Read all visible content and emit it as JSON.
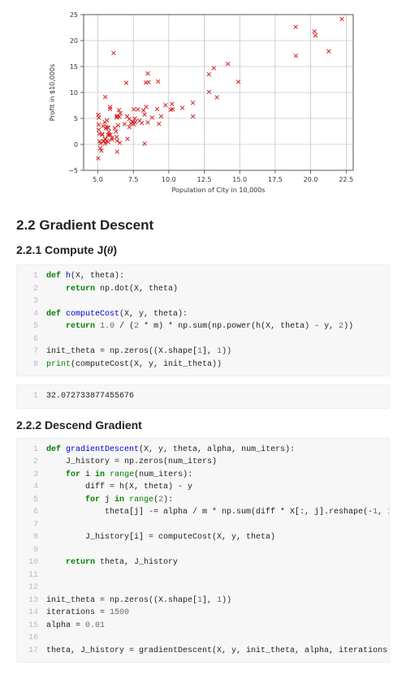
{
  "chart_data": {
    "type": "scatter",
    "xlabel": "Population of City in 10,000s",
    "ylabel": "Profit in $10,000s",
    "xlim": [
      4,
      23
    ],
    "ylim": [
      -5,
      25
    ],
    "xticks": [
      5.0,
      7.5,
      10.0,
      12.5,
      15.0,
      17.5,
      20.0,
      22.5
    ],
    "yticks": [
      -5,
      0,
      5,
      10,
      15,
      20,
      25
    ],
    "marker": "x",
    "marker_color": "#d62728",
    "points": [
      [
        6.1101,
        17.592
      ],
      [
        5.5277,
        9.1302
      ],
      [
        8.5186,
        13.662
      ],
      [
        7.0032,
        11.854
      ],
      [
        5.8598,
        6.8233
      ],
      [
        8.3829,
        11.886
      ],
      [
        7.4764,
        4.3483
      ],
      [
        8.5781,
        12.0
      ],
      [
        6.4862,
        6.5987
      ],
      [
        5.0546,
        3.8166
      ],
      [
        5.7107,
        3.2522
      ],
      [
        14.164,
        15.505
      ],
      [
        5.734,
        3.1551
      ],
      [
        8.4084,
        7.2258
      ],
      [
        5.6407,
        0.71618
      ],
      [
        5.3794,
        3.5129
      ],
      [
        6.3654,
        5.3048
      ],
      [
        5.1301,
        0.56077
      ],
      [
        6.4296,
        3.6518
      ],
      [
        7.0708,
        5.3893
      ],
      [
        6.1891,
        3.1386
      ],
      [
        20.27,
        21.767
      ],
      [
        5.4901,
        4.263
      ],
      [
        6.3261,
        5.1875
      ],
      [
        5.5649,
        3.0825
      ],
      [
        18.945,
        22.638
      ],
      [
        12.828,
        13.501
      ],
      [
        10.957,
        7.0467
      ],
      [
        13.176,
        14.692
      ],
      [
        22.203,
        24.147
      ],
      [
        5.2524,
        -1.22
      ],
      [
        6.5894,
        5.9966
      ],
      [
        9.2482,
        12.134
      ],
      [
        5.8918,
        1.8495
      ],
      [
        8.2111,
        6.5426
      ],
      [
        7.9334,
        4.5623
      ],
      [
        8.0959,
        4.1164
      ],
      [
        5.6063,
        3.3928
      ],
      [
        12.836,
        10.117
      ],
      [
        6.3534,
        5.4974
      ],
      [
        5.4069,
        0.55657
      ],
      [
        6.8825,
        3.9115
      ],
      [
        11.708,
        5.3854
      ],
      [
        5.7737,
        2.4406
      ],
      [
        7.8247,
        6.7318
      ],
      [
        7.0931,
        1.0463
      ],
      [
        5.0702,
        5.1337
      ],
      [
        5.8014,
        1.844
      ],
      [
        11.7,
        8.0043
      ],
      [
        5.5416,
        1.0179
      ],
      [
        7.5402,
        6.7504
      ],
      [
        5.3077,
        1.8396
      ],
      [
        7.4239,
        4.2885
      ],
      [
        7.6031,
        4.9981
      ],
      [
        6.3328,
        1.4233
      ],
      [
        6.3589,
        -1.4211
      ],
      [
        6.2742,
        2.4756
      ],
      [
        5.6397,
        4.6042
      ],
      [
        9.3102,
        3.9624
      ],
      [
        9.4536,
        5.4141
      ],
      [
        8.8254,
        5.1694
      ],
      [
        5.1793,
        -0.74279
      ],
      [
        21.279,
        17.929
      ],
      [
        14.908,
        12.054
      ],
      [
        18.959,
        17.054
      ],
      [
        7.2182,
        4.8852
      ],
      [
        8.2951,
        5.7442
      ],
      [
        10.236,
        7.7754
      ],
      [
        5.4994,
        1.0173
      ],
      [
        20.341,
        20.992
      ],
      [
        10.136,
        6.6799
      ],
      [
        7.3345,
        4.0259
      ],
      [
        6.0062,
        1.2784
      ],
      [
        7.2259,
        3.3411
      ],
      [
        5.0269,
        -2.6807
      ],
      [
        6.5479,
        0.29678
      ],
      [
        7.5386,
        3.8845
      ],
      [
        5.0365,
        5.7014
      ],
      [
        10.274,
        6.7526
      ],
      [
        5.1077,
        2.0576
      ],
      [
        5.7292,
        0.47953
      ],
      [
        5.1884,
        0.20421
      ],
      [
        6.3557,
        0.67861
      ],
      [
        9.7687,
        7.5435
      ],
      [
        6.5159,
        5.3436
      ],
      [
        8.5172,
        4.2415
      ],
      [
        9.1802,
        6.7981
      ],
      [
        6.002,
        0.92695
      ],
      [
        5.5204,
        0.152
      ],
      [
        5.0594,
        2.8214
      ],
      [
        5.7077,
        1.8451
      ],
      [
        7.6366,
        4.2959
      ],
      [
        5.8707,
        7.2029
      ],
      [
        5.3054,
        1.9869
      ],
      [
        8.2934,
        0.14454
      ],
      [
        13.394,
        9.0551
      ],
      [
        5.4369,
        0.61705
      ]
    ]
  },
  "sections": {
    "h2": "2.2 Gradient Descent",
    "h3a_prefix": "2.2.1 Compute J(",
    "h3a_theta": "θ",
    "h3a_suffix": ")",
    "h3b": "2.2.2 Descend Gradient"
  },
  "code1": {
    "lines": [
      [
        [
          "kw",
          "def"
        ],
        [
          "txt",
          " "
        ],
        [
          "fn",
          "h"
        ],
        [
          "txt",
          "(X, theta):"
        ]
      ],
      [
        [
          "txt",
          "    "
        ],
        [
          "kw",
          "return"
        ],
        [
          "txt",
          " np.dot(X, theta)"
        ]
      ],
      [
        [
          "txt",
          ""
        ]
      ],
      [
        [
          "kw",
          "def"
        ],
        [
          "txt",
          " "
        ],
        [
          "fn",
          "computeCost"
        ],
        [
          "txt",
          "(X, y, theta):"
        ]
      ],
      [
        [
          "txt",
          "    "
        ],
        [
          "kw",
          "return"
        ],
        [
          "txt",
          " "
        ],
        [
          "num",
          "1.0"
        ],
        [
          "txt",
          " / ("
        ],
        [
          "num",
          "2"
        ],
        [
          "txt",
          " * m) * np.sum(np.power(h(X, theta) - y, "
        ],
        [
          "num",
          "2"
        ],
        [
          "txt",
          "))"
        ]
      ],
      [
        [
          "txt",
          ""
        ]
      ],
      [
        [
          "txt",
          "init_theta = np.zeros((X.shape["
        ],
        [
          "num",
          "1"
        ],
        [
          "txt",
          "], "
        ],
        [
          "num",
          "1"
        ],
        [
          "txt",
          "))"
        ]
      ],
      [
        [
          "builtin",
          "print"
        ],
        [
          "txt",
          "(computeCost(X, y, init_theta))"
        ]
      ]
    ]
  },
  "output1": {
    "lines": [
      [
        [
          "txt",
          "32.072733877455676"
        ]
      ]
    ]
  },
  "code2": {
    "lines": [
      [
        [
          "kw",
          "def"
        ],
        [
          "txt",
          " "
        ],
        [
          "fn",
          "gradientDescent"
        ],
        [
          "txt",
          "(X, y, theta, alpha, num_iters):"
        ]
      ],
      [
        [
          "txt",
          "    J_history = np.zeros(num_iters)"
        ]
      ],
      [
        [
          "txt",
          "    "
        ],
        [
          "kw",
          "for"
        ],
        [
          "txt",
          " i "
        ],
        [
          "kw",
          "in"
        ],
        [
          "txt",
          " "
        ],
        [
          "builtin",
          "range"
        ],
        [
          "txt",
          "(num_iters):"
        ]
      ],
      [
        [
          "txt",
          "        diff = h(X, theta) - y"
        ]
      ],
      [
        [
          "txt",
          "        "
        ],
        [
          "kw",
          "for"
        ],
        [
          "txt",
          " j "
        ],
        [
          "kw",
          "in"
        ],
        [
          "txt",
          " "
        ],
        [
          "builtin",
          "range"
        ],
        [
          "txt",
          "("
        ],
        [
          "num",
          "2"
        ],
        [
          "txt",
          "):"
        ]
      ],
      [
        [
          "txt",
          "            theta[j] -= alpha / m * np.sum(diff * X[:, j].reshape(-"
        ],
        [
          "num",
          "1"
        ],
        [
          "txt",
          ", "
        ],
        [
          "num",
          "1"
        ],
        [
          "txt",
          "))"
        ]
      ],
      [
        [
          "txt",
          ""
        ]
      ],
      [
        [
          "txt",
          "        J_history[i] = computeCost(X, y, theta)"
        ]
      ],
      [
        [
          "txt",
          ""
        ]
      ],
      [
        [
          "txt",
          "    "
        ],
        [
          "kw",
          "return"
        ],
        [
          "txt",
          " theta, J_history"
        ]
      ],
      [
        [
          "txt",
          ""
        ]
      ],
      [
        [
          "txt",
          ""
        ]
      ],
      [
        [
          "txt",
          "init_theta = np.zeros((X.shape["
        ],
        [
          "num",
          "1"
        ],
        [
          "txt",
          "], "
        ],
        [
          "num",
          "1"
        ],
        [
          "txt",
          "))"
        ]
      ],
      [
        [
          "txt",
          "iterations = "
        ],
        [
          "num",
          "1500"
        ]
      ],
      [
        [
          "txt",
          "alpha = "
        ],
        [
          "num",
          "0.01"
        ]
      ],
      [
        [
          "txt",
          ""
        ]
      ],
      [
        [
          "txt",
          "theta, J_history = gradientDescent(X, y, init_theta, alpha, iterations)"
        ]
      ]
    ]
  }
}
